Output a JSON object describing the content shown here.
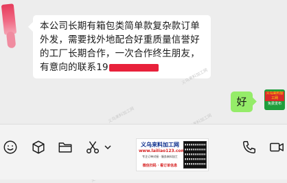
{
  "chat": {
    "incoming": {
      "lines": [
        "本公司长期有箱包类简单款复杂款订单",
        "外发，需要找外地配合好重质量信誉好",
        "的工厂长期合作，一次合作终生朋友，",
        "有意向的联系19"
      ],
      "redaction_color": "#e8213b"
    },
    "outgoing": {
      "text": "好"
    },
    "self_avatar": {
      "top_text": "义乌来料加工网",
      "bottom_text": "免费发布"
    },
    "watermark_text": "义乌来料加工网"
  },
  "toolbar": {
    "icons": [
      "emoji-icon",
      "package-icon",
      "folder-icon",
      "scissors-icon",
      "chevron-down-icon",
      "phone-icon",
      "video-icon"
    ],
    "ad": {
      "title": "义乌来料加工网",
      "url": "www.laiIiao123.com",
      "sub": "专注订单对接 · 服务来料加工",
      "bottom": "微信扫码 · 看订单信息"
    }
  },
  "colors": {
    "outgoing_bubble": "#95ec69",
    "incoming_bubble": "#ffffff",
    "background": "#ededed"
  }
}
